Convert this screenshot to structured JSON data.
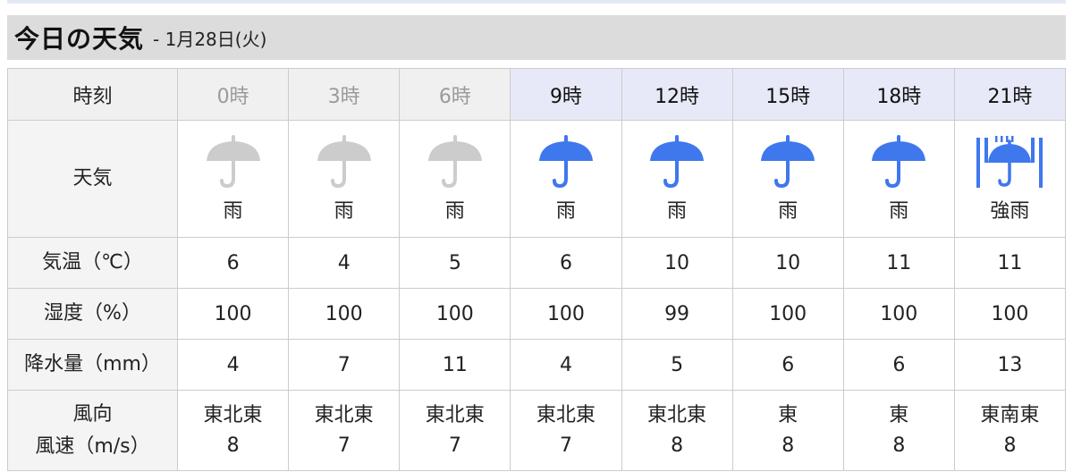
{
  "header": {
    "title": "今日の天気",
    "subtitle": "- 1月28日(火)"
  },
  "labels": {
    "time": "時刻",
    "weather": "天気",
    "temp": "気温（℃）",
    "humidity": "湿度（%）",
    "precip": "降水量（mm）",
    "wind_dir": "風向",
    "wind_speed": "風速（m/s）"
  },
  "colors": {
    "past_icon": "#cccccc",
    "future_icon": "#3f77ed",
    "past_text": "#9a9a9a"
  },
  "columns": [
    {
      "time": "0時",
      "state": "past",
      "icon": "umbrella-icon",
      "weather": "雨",
      "temp": "6",
      "humidity": "100",
      "precip": "4",
      "wind_dir": "東北東",
      "wind_speed": "8"
    },
    {
      "time": "3時",
      "state": "past",
      "icon": "umbrella-icon",
      "weather": "雨",
      "temp": "4",
      "humidity": "100",
      "precip": "7",
      "wind_dir": "東北東",
      "wind_speed": "7"
    },
    {
      "time": "6時",
      "state": "past",
      "icon": "umbrella-icon",
      "weather": "雨",
      "temp": "5",
      "humidity": "100",
      "precip": "11",
      "wind_dir": "東北東",
      "wind_speed": "7"
    },
    {
      "time": "9時",
      "state": "future",
      "icon": "umbrella-icon",
      "weather": "雨",
      "temp": "6",
      "humidity": "100",
      "precip": "4",
      "wind_dir": "東北東",
      "wind_speed": "7"
    },
    {
      "time": "12時",
      "state": "future",
      "icon": "umbrella-icon",
      "weather": "雨",
      "temp": "10",
      "humidity": "99",
      "precip": "5",
      "wind_dir": "東北東",
      "wind_speed": "8"
    },
    {
      "time": "15時",
      "state": "future",
      "icon": "umbrella-icon",
      "weather": "雨",
      "temp": "10",
      "humidity": "100",
      "precip": "6",
      "wind_dir": "東",
      "wind_speed": "8"
    },
    {
      "time": "18時",
      "state": "future",
      "icon": "umbrella-icon",
      "weather": "雨",
      "temp": "11",
      "humidity": "100",
      "precip": "6",
      "wind_dir": "東",
      "wind_speed": "8"
    },
    {
      "time": "21時",
      "state": "future",
      "icon": "heavy-rain-umbrella-icon",
      "weather": "強雨",
      "temp": "11",
      "humidity": "100",
      "precip": "13",
      "wind_dir": "東南東",
      "wind_speed": "8"
    }
  ]
}
